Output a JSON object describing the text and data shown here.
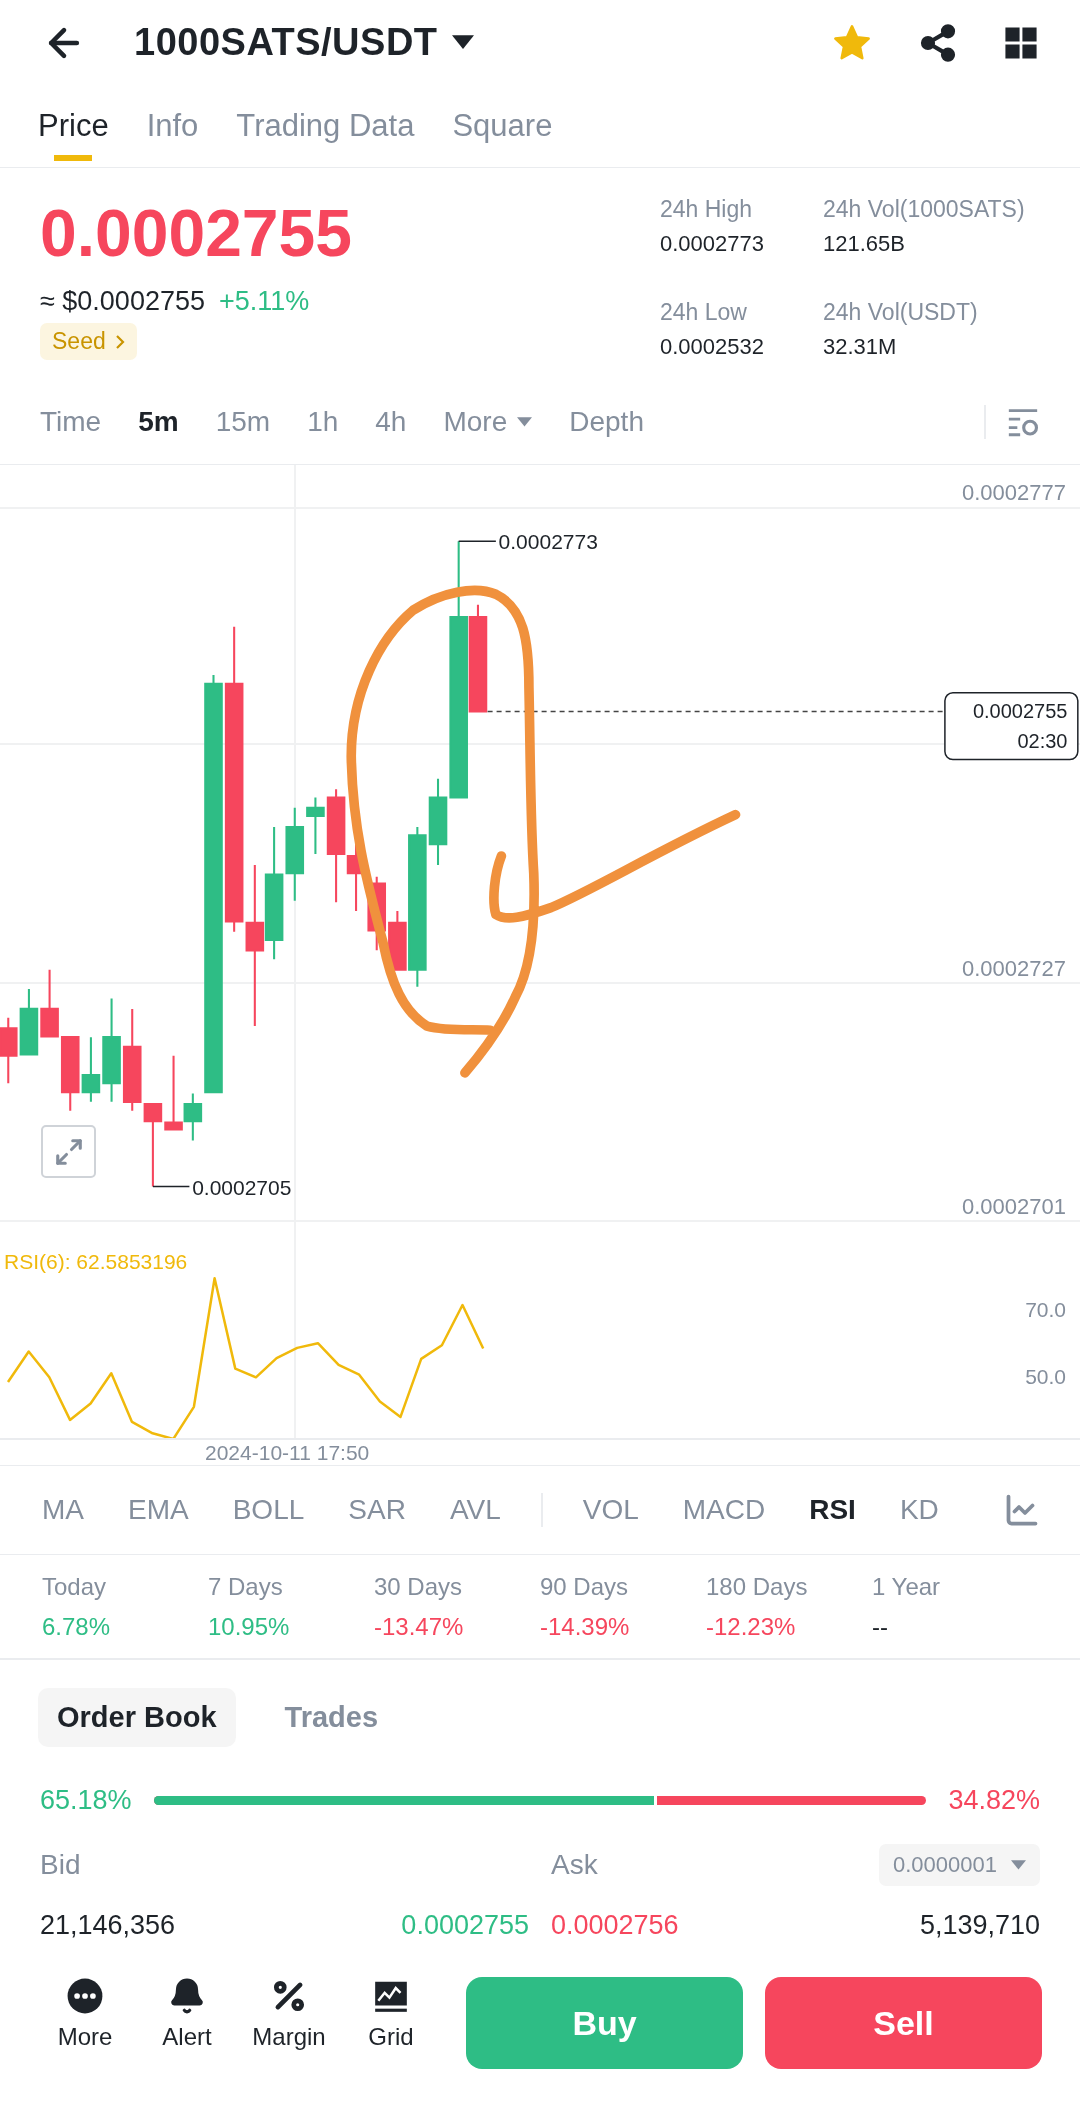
{
  "header": {
    "title": "1000SATS/USDT",
    "favorite": true
  },
  "tabs": [
    {
      "label": "Price",
      "selected": true
    },
    {
      "label": "Info",
      "selected": false
    },
    {
      "label": "Trading Data",
      "selected": false
    },
    {
      "label": "Square",
      "selected": false
    }
  ],
  "price": {
    "last": "0.0002755",
    "fiat": "≈ $0.0002755",
    "change": "+5.11%",
    "tag": "Seed"
  },
  "stats": [
    {
      "label": "24h High",
      "value": "0.0002773"
    },
    {
      "label": "24h Vol(1000SATS)",
      "value": "121.65B"
    },
    {
      "label": "24h Low",
      "value": "0.0002532"
    },
    {
      "label": "24h Vol(USDT)",
      "value": "32.31M"
    }
  ],
  "intervals": [
    {
      "label": "Time",
      "selected": false,
      "kind": "option"
    },
    {
      "label": "5m",
      "selected": true,
      "kind": "option"
    },
    {
      "label": "15m",
      "selected": false,
      "kind": "option"
    },
    {
      "label": "1h",
      "selected": false,
      "kind": "option"
    },
    {
      "label": "4h",
      "selected": false,
      "kind": "option"
    },
    {
      "label": "More",
      "selected": false,
      "kind": "dropdown"
    },
    {
      "label": "Depth",
      "selected": false,
      "kind": "option"
    }
  ],
  "price_chart": {
    "y_labels": [
      "0.0002777",
      "0.0002727",
      "0.0002701"
    ],
    "high_label": "0.0002773",
    "low_label": "0.0002705",
    "current_price": "0.0002755",
    "countdown": "02:30"
  },
  "rsi_chart": {
    "title": "RSI(6): 62.5853196",
    "y_labels": [
      "70.0",
      "50.0"
    ],
    "time_label": "2024-10-11 17:50"
  },
  "main_indicators": [
    {
      "label": "MA",
      "selected": false
    },
    {
      "label": "EMA",
      "selected": false
    },
    {
      "label": "BOLL",
      "selected": false
    },
    {
      "label": "SAR",
      "selected": false
    },
    {
      "label": "AVL",
      "selected": false
    }
  ],
  "sub_indicators": [
    {
      "label": "VOL",
      "selected": false
    },
    {
      "label": "MACD",
      "selected": false
    },
    {
      "label": "RSI",
      "selected": true
    },
    {
      "label": "KD",
      "selected": false
    }
  ],
  "performance": [
    {
      "period": "Today",
      "value": "6.78%",
      "color": "#2ebd85"
    },
    {
      "period": "7 Days",
      "value": "10.95%",
      "color": "#2ebd85"
    },
    {
      "period": "30 Days",
      "value": "-13.47%",
      "color": "#f6465d"
    },
    {
      "period": "90 Days",
      "value": "-14.39%",
      "color": "#f6465d"
    },
    {
      "period": "180 Days",
      "value": "-12.23%",
      "color": "#f6465d"
    },
    {
      "period": "1 Year",
      "value": "--",
      "color": "#1e2329"
    }
  ],
  "book_tabs": [
    {
      "label": "Order Book",
      "selected": true
    },
    {
      "label": "Trades",
      "selected": false
    }
  ],
  "ratio": {
    "bid": "65.18%",
    "ask": "34.82%",
    "level": 0.6518
  },
  "order_book": {
    "bid_header": "Bid",
    "ask_header": "Ask",
    "precision": "0.0000001",
    "bid_qty": "21,146,356",
    "bid_price": "0.0002755",
    "ask_price": "0.0002756",
    "ask_qty": "5,139,710"
  },
  "actions": [
    {
      "label": "More",
      "kind": "more"
    },
    {
      "label": "Alert",
      "kind": "alert"
    },
    {
      "label": "Margin",
      "kind": "margin"
    },
    {
      "label": "Grid",
      "kind": "grid"
    }
  ],
  "trade_buttons": [
    {
      "label": "Buy",
      "kind": "buy"
    },
    {
      "label": "Sell",
      "kind": "sell"
    }
  ]
}
